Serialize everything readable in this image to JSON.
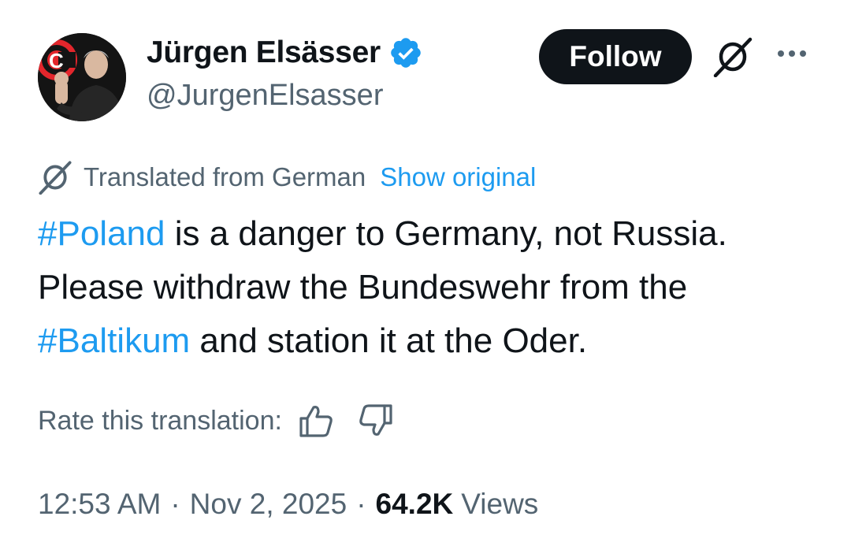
{
  "author": {
    "name": "Jürgen Elsässer",
    "handle": "@JurgenElsasser",
    "verified": true,
    "avatar_logo_letter": "C"
  },
  "actions": {
    "follow_label": "Follow",
    "grok_icon": "grok-icon",
    "more_icon": "more-horizontal-icon"
  },
  "translation": {
    "icon": "translate-icon",
    "label": "Translated from German",
    "show_original_label": "Show original"
  },
  "tweet": {
    "lines": [
      {
        "hashtag": "#Poland",
        "text": " is a danger to Germany, not Russia."
      },
      {
        "text": "Please withdraw the Bundeswehr from the"
      },
      {
        "hashtag": "#Baltikum",
        "text": " and station it at the Oder."
      }
    ]
  },
  "rating": {
    "label": "Rate this translation:",
    "thumbs_up_icon": "thumbs-up-icon",
    "thumbs_down_icon": "thumbs-down-icon"
  },
  "meta": {
    "time": "12:53 AM",
    "separator": "·",
    "date": "Nov 2, 2025",
    "views_count": "64.2K",
    "views_label": "Views"
  },
  "colors": {
    "text_primary": "#0f1419",
    "text_secondary": "#536471",
    "link": "#1d9bf0",
    "follow_button_bg": "#0f1419",
    "verified_badge": "#1d9bf0",
    "avatar_logo": "#e3262c"
  }
}
